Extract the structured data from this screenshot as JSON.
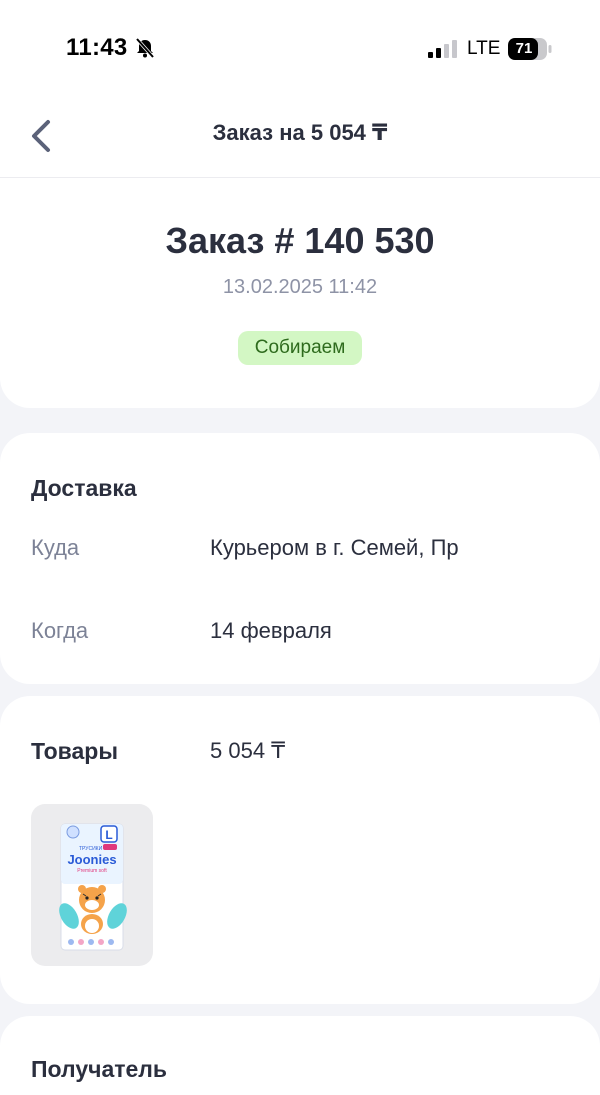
{
  "status_bar": {
    "time": "11:43",
    "network": "LTE",
    "battery": "71"
  },
  "nav": {
    "title": "Заказ на 5 054 ₸"
  },
  "order": {
    "number": "Заказ # 140 530",
    "date": "13.02.2025 11:42",
    "status": "Собираем",
    "status_color": "#d3f7c4"
  },
  "delivery": {
    "title": "Доставка",
    "where_label": "Куда",
    "where_value": "Курьером в г. Семей, Пр",
    "when_label": "Когда",
    "when_value": "14 февраля"
  },
  "products": {
    "title": "Товары",
    "total": "5 054 ₸",
    "items": [
      {
        "name": "product-image-joonies-diapers"
      }
    ]
  },
  "recipient": {
    "title": "Получатель"
  }
}
